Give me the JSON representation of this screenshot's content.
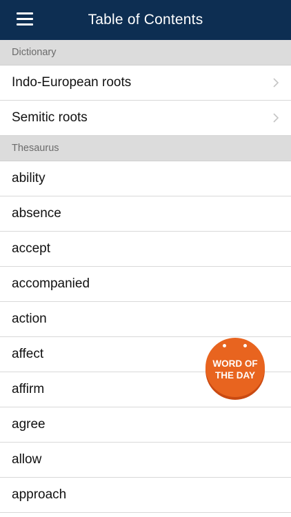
{
  "header": {
    "title": "Table of Contents",
    "menu_icon": "hamburger-menu-icon",
    "background": "#0d2e52"
  },
  "sections": [
    {
      "header": "Dictionary",
      "items": [
        {
          "label": "Indo-European roots",
          "icon": "chevron-right-icon"
        },
        {
          "label": "Semitic roots",
          "icon": "chevron-right-icon"
        }
      ]
    },
    {
      "header": "Thesaurus",
      "items": [
        {
          "label": "ability"
        },
        {
          "label": "absence"
        },
        {
          "label": "accept"
        },
        {
          "label": "accompanied"
        },
        {
          "label": "action"
        },
        {
          "label": "affect"
        },
        {
          "label": "affirm"
        },
        {
          "label": "agree"
        },
        {
          "label": "allow"
        },
        {
          "label": "approach"
        }
      ]
    }
  ],
  "word_of_the_day": {
    "line1": "WORD OF",
    "line2": "THE DAY",
    "color": "#e8641f"
  }
}
